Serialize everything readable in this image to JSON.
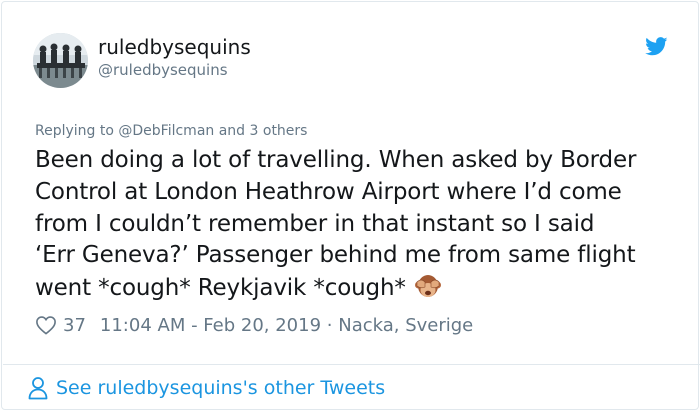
{
  "tweet": {
    "display_name": "ruledbysequins",
    "handle": "@ruledbysequins",
    "replying_prefix": "Replying to ",
    "replying_mention": "@DebFilcman",
    "replying_suffix": " and 3 others",
    "text_lines": [
      "Been doing a lot of travelling. When asked by Border",
      "Control at London Heathrow Airport where I’d come",
      "from I couldn’t remember in that instant so I said",
      "‘Err Geneva?’ Passenger behind me from same flight",
      "went *cough* Reykjavik *cough*"
    ],
    "emoji": "see-no-evil-monkey",
    "likes": "37",
    "timestamp": "11:04 AM - Feb 20, 2019",
    "separator": "·",
    "location": "Nacka, Sverige",
    "see_more": "See ruledbysequins's other Tweets"
  },
  "colors": {
    "twitter_blue": "#1da1f2",
    "link_blue": "#1b95e0",
    "muted": "#657786",
    "text": "#14171a"
  },
  "icons": [
    "twitter-bird-icon",
    "heart-icon",
    "person-icon"
  ]
}
